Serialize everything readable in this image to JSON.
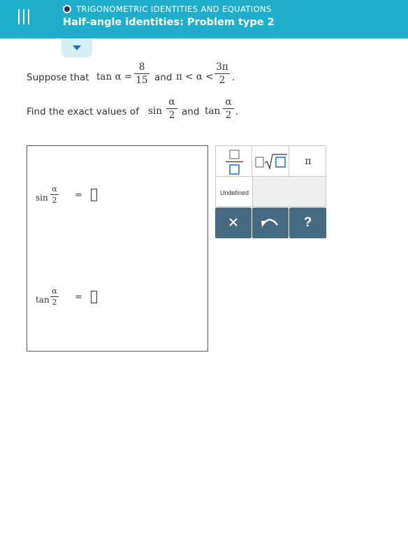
{
  "header": {
    "topic": "TRIGONOMETRIC IDENTITIES AND EQUATIONS",
    "title": "Half-angle identities: Problem type 2"
  },
  "problem": {
    "line1_prefix": "Suppose that",
    "tan_alpha": "tan α =",
    "frac1": {
      "num": "8",
      "den": "15"
    },
    "and1": "and",
    "ineq": "π < α <",
    "frac2": {
      "num": "3π",
      "den": "2"
    },
    "period1": ".",
    "line2_prefix": "Find the exact values of",
    "sin": "sin",
    "half_num": "α",
    "half_den": "2",
    "and2": "and",
    "tan": "tan",
    "period2": "."
  },
  "answers": {
    "sin_label": "sin",
    "tan_label": "tan",
    "half_num": "α",
    "half_den": "2",
    "equals": "=",
    "sin_value": "",
    "tan_value": ""
  },
  "keypad": {
    "keys": [
      "fraction-key",
      "sqrt-key",
      "pi-key"
    ],
    "pi_label": "π",
    "undefined_label": "Undefined",
    "help_label": "?"
  },
  "colors": {
    "header": "#1faecb",
    "accent_blue": "#1a6ec7",
    "action_button": "#466b80"
  }
}
